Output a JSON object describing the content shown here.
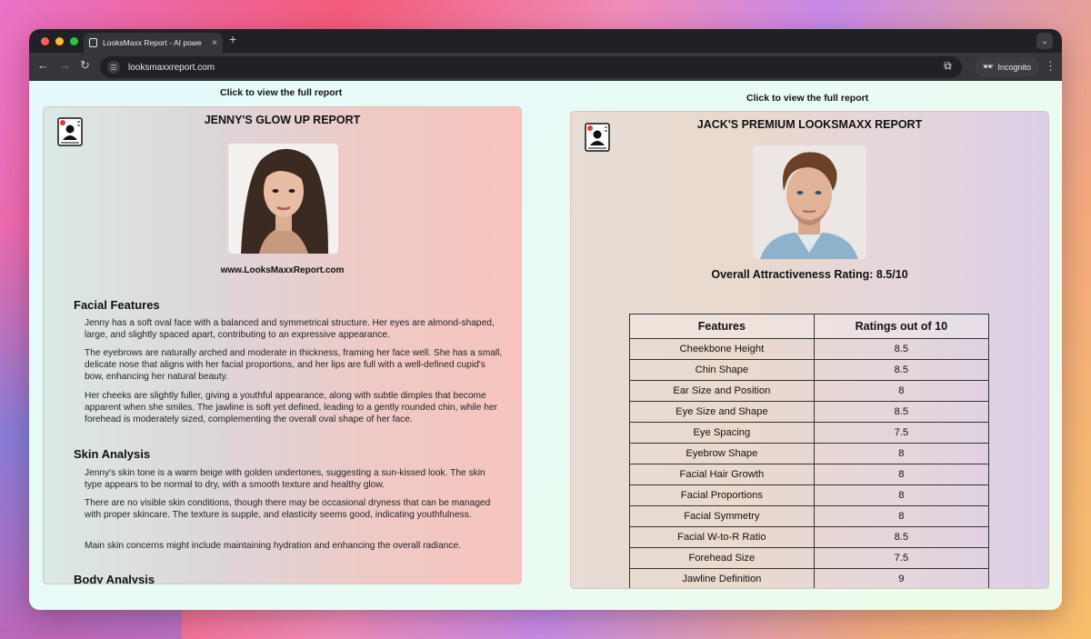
{
  "browser": {
    "tab_title": "LooksMaxx Report - AI powe",
    "tab_close": "×",
    "new_tab": "+",
    "url": "looksmaxxreport.com",
    "incognito_label": "Incognito",
    "traffic_lights": [
      "#ff5f57",
      "#febc2e",
      "#28c840"
    ]
  },
  "left": {
    "caption": "Click to view the full report",
    "title": "JENNY'S GLOW UP REPORT",
    "site": "www.LooksMaxxReport.com",
    "sections": [
      {
        "heading": "Facial Features",
        "paragraphs": [
          "Jenny has a soft oval face with a balanced and symmetrical structure. Her eyes are almond-shaped, large, and slightly spaced apart, contributing to an expressive appearance.",
          "The eyebrows are naturally arched and moderate in thickness, framing her face well. She has a small, delicate nose that aligns with her facial proportions, and her lips are full with a well-defined cupid's bow, enhancing her natural beauty.",
          "Her cheeks are slightly fuller, giving a youthful appearance, along with subtle dimples that become apparent when she smiles. The jawline is soft yet defined, leading to a gently rounded chin, while her forehead is moderately sized, complementing the overall oval shape of her face."
        ]
      },
      {
        "heading": "Skin Analysis",
        "paragraphs": [
          "Jenny's skin tone is a warm beige with golden undertones, suggesting a sun-kissed look. The skin type appears to be normal to dry, with a smooth texture and healthy glow.",
          "There are no visible skin conditions, though there may be occasional dryness that can be managed with proper skincare. The texture is supple, and elasticity seems good, indicating youthfulness.",
          "Main skin concerns might include maintaining hydration and enhancing the overall radiance."
        ]
      },
      {
        "heading": "Body Analysis",
        "paragraphs": []
      }
    ]
  },
  "right": {
    "caption": "Click to view the full report",
    "title": "JACK'S PREMIUM LOOKSMAXX REPORT",
    "overall": "Overall Attractiveness Rating: 8.5/10",
    "table": {
      "headers": [
        "Features",
        "Ratings out of 10"
      ],
      "rows": [
        [
          "Cheekbone Height",
          "8.5"
        ],
        [
          "Chin Shape",
          "8.5"
        ],
        [
          "Ear Size and Position",
          "8"
        ],
        [
          "Eye Size and Shape",
          "8.5"
        ],
        [
          "Eye Spacing",
          "7.5"
        ],
        [
          "Eyebrow Shape",
          "8"
        ],
        [
          "Facial Hair Growth",
          "8"
        ],
        [
          "Facial Proportions",
          "8"
        ],
        [
          "Facial Symmetry",
          "8"
        ],
        [
          "Facial W-to-R Ratio",
          "8.5"
        ],
        [
          "Forehead Size",
          "7.5"
        ],
        [
          "Jawline Definition",
          "9"
        ]
      ]
    }
  }
}
